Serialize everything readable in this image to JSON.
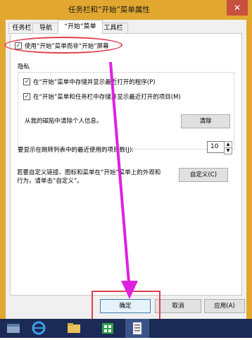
{
  "window": {
    "title": "任务栏和“开始”菜单属性",
    "close_glyph": "✕",
    "frame_color": "#e2a72f"
  },
  "tabs": [
    {
      "label": "任务栏"
    },
    {
      "label": "导航"
    },
    {
      "label": "“开始”菜单",
      "active": true
    },
    {
      "label": "工具栏"
    }
  ],
  "start_menu": {
    "use_start_menu_label": "使用“开始”菜单而非“开始”屏幕",
    "use_start_menu_checked": true,
    "privacy_group_label": "隐私",
    "store_recent_programs_label": "在“开始”菜单中存储并显示最近打开的程序(P)",
    "store_recent_programs_checked": true,
    "store_recent_items_label": "在“开始”菜单和任务栏中存储并显示最近打开的项目(M)",
    "store_recent_items_checked": true,
    "clear_tiles_label": "从我的磁贴中清除个人信息。",
    "clear_button": "清除",
    "jump_list_label": "要显示在跳转列表中的最近使用的项目数(J):",
    "jump_list_value": "10",
    "customize_text_line1": "若要自定义链接、图标和菜单在“开始”菜单上的外观和",
    "customize_text_line2": "行为，请单击“自定义”。",
    "customize_button": "自定义(C)"
  },
  "footer": {
    "ok_button": "确定",
    "cancel_button": "取消",
    "apply_button": "应用(A)"
  },
  "annotations": {
    "color": "#e04050",
    "arrow_color": "#e020e0"
  },
  "taskbar": {
    "background": "#1b2b55",
    "icons": [
      "file-explorer-icon",
      "internet-explorer-icon",
      "folder-icon",
      "store-icon",
      "taskbar-properties-icon"
    ]
  }
}
